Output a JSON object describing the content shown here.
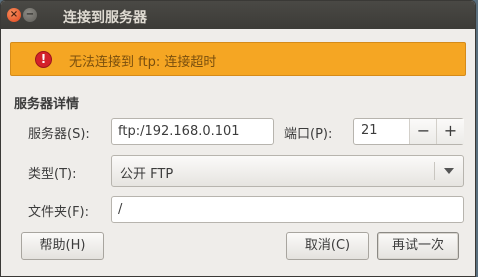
{
  "window": {
    "title": "连接到服务器",
    "close_glyph": "×",
    "minimize_glyph": "−"
  },
  "infobar": {
    "icon": "error-icon",
    "icon_glyph": "!",
    "message": "无法连接到 ftp: 连接超时",
    "color": "#f5a623"
  },
  "server_details": {
    "heading": "服务器详情",
    "server_label": "服务器(S):",
    "server_value": "ftp:/192.168.0.101",
    "port_label": "端口(P):",
    "port_value": "21",
    "port_decrement": "−",
    "port_increment": "+",
    "type_label": "类型(T):",
    "type_value": "公开 FTP",
    "folder_label": "文件夹(F):",
    "folder_value": "/"
  },
  "buttons": {
    "help": "帮助(H)",
    "cancel": "取消(C)",
    "retry": "再试一次"
  }
}
